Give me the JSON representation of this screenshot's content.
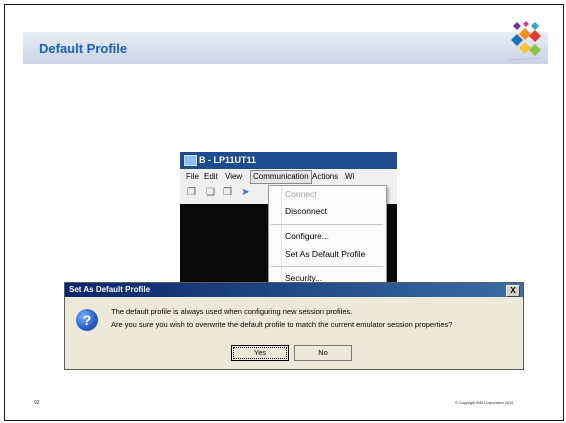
{
  "slide": {
    "title": "Default Profile",
    "page_number": "92",
    "copyright": "© Copyright IBM Corporation 2015"
  },
  "emulator": {
    "title": "B - LP11UT11",
    "menu": [
      "File",
      "Edit",
      "View",
      "Communication",
      "Actions",
      "Wi"
    ],
    "dropdown": [
      "Connect",
      "Disconnect",
      "Configure...",
      "Set As Default Profile",
      "Security..."
    ]
  },
  "dialog": {
    "title": "Set As Default Profile",
    "close": "X",
    "line1": "The default profile is always used when configuring new session profiles.",
    "line2": "Are you sure you wish to overwrite the default profile to match the current emulator session properties?",
    "yes": "Yes",
    "no": "No",
    "icon": "question-icon"
  },
  "colors": {
    "slide_title": "#1b5fb0",
    "emu_title_bar": "#1f4c8f",
    "dialog_title_bar": "#0a246a"
  }
}
